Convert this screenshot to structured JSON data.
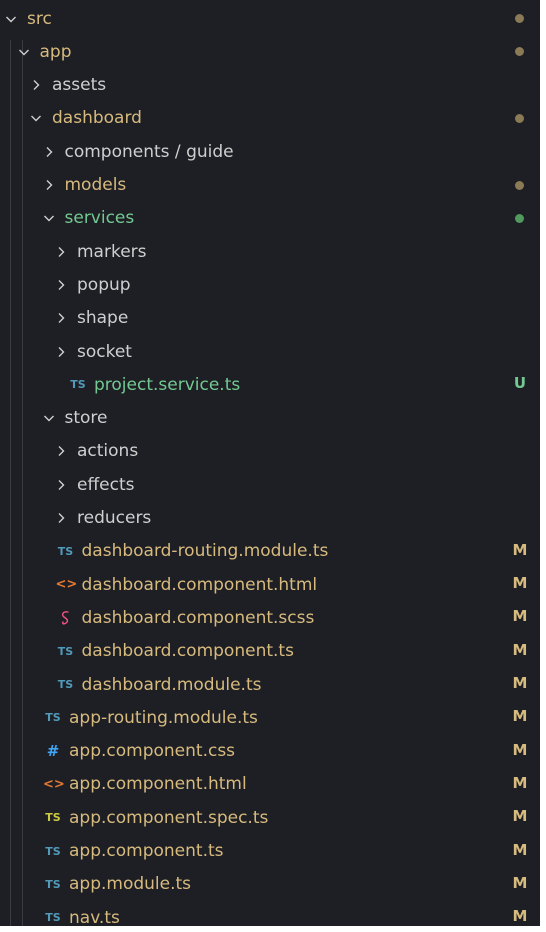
{
  "colors": {
    "background": "#1e1f25",
    "folder_text": "#cfcfcf",
    "modified_text": "#d7ba7d",
    "untracked_text": "#73c991",
    "modified_dot": "#8a7a55",
    "untracked_dot": "#4f9a5c",
    "ts_icon": "#519aba",
    "spec_icon": "#cbcb41",
    "html_icon": "#e37933",
    "css_icon": "#42a5f5",
    "scss_icon": "#f55385"
  },
  "tree": [
    {
      "name": "src",
      "kind": "folder",
      "depth": 0,
      "expanded": true,
      "dot": "modified"
    },
    {
      "name": "app",
      "kind": "folder",
      "depth": 1,
      "expanded": true,
      "dot": "modified"
    },
    {
      "name": "assets",
      "kind": "folder",
      "depth": 2,
      "expanded": false
    },
    {
      "name": "dashboard",
      "kind": "folder",
      "depth": 2,
      "expanded": true,
      "dot": "modified"
    },
    {
      "name": "components / guide",
      "kind": "folder",
      "depth": 3,
      "expanded": false
    },
    {
      "name": "models",
      "kind": "folder",
      "depth": 3,
      "expanded": false,
      "dot": "modified"
    },
    {
      "name": "services",
      "kind": "folder",
      "depth": 3,
      "expanded": true,
      "dot": "untracked"
    },
    {
      "name": "markers",
      "kind": "folder",
      "depth": 4,
      "expanded": false
    },
    {
      "name": "popup",
      "kind": "folder",
      "depth": 4,
      "expanded": false
    },
    {
      "name": "shape",
      "kind": "folder",
      "depth": 4,
      "expanded": false
    },
    {
      "name": "socket",
      "kind": "folder",
      "depth": 4,
      "expanded": false
    },
    {
      "name": "project.service.ts",
      "kind": "file",
      "icon": "TS",
      "icon_type": "ts",
      "depth": 4,
      "status": "U"
    },
    {
      "name": "store",
      "kind": "folder",
      "depth": 3,
      "expanded": true
    },
    {
      "name": "actions",
      "kind": "folder",
      "depth": 4,
      "expanded": false
    },
    {
      "name": "effects",
      "kind": "folder",
      "depth": 4,
      "expanded": false
    },
    {
      "name": "reducers",
      "kind": "folder",
      "depth": 4,
      "expanded": false
    },
    {
      "name": "dashboard-routing.module.ts",
      "kind": "file",
      "icon": "TS",
      "icon_type": "ts",
      "depth": 3,
      "status": "M"
    },
    {
      "name": "dashboard.component.html",
      "kind": "file",
      "icon": "<>",
      "icon_type": "html",
      "depth": 3,
      "status": "M"
    },
    {
      "name": "dashboard.component.scss",
      "kind": "file",
      "icon": "sass",
      "icon_type": "scss",
      "depth": 3,
      "status": "M"
    },
    {
      "name": "dashboard.component.ts",
      "kind": "file",
      "icon": "TS",
      "icon_type": "ts",
      "depth": 3,
      "status": "M"
    },
    {
      "name": "dashboard.module.ts",
      "kind": "file",
      "icon": "TS",
      "icon_type": "ts",
      "depth": 3,
      "status": "M"
    },
    {
      "name": "app-routing.module.ts",
      "kind": "file",
      "icon": "TS",
      "icon_type": "ts",
      "depth": 2,
      "status": "M"
    },
    {
      "name": "app.component.css",
      "kind": "file",
      "icon": "#",
      "icon_type": "css",
      "depth": 2,
      "status": "M"
    },
    {
      "name": "app.component.html",
      "kind": "file",
      "icon": "<>",
      "icon_type": "html",
      "depth": 2,
      "status": "M"
    },
    {
      "name": "app.component.spec.ts",
      "kind": "file",
      "icon": "TS",
      "icon_type": "spec",
      "depth": 2,
      "status": "M"
    },
    {
      "name": "app.component.ts",
      "kind": "file",
      "icon": "TS",
      "icon_type": "ts",
      "depth": 2,
      "status": "M"
    },
    {
      "name": "app.module.ts",
      "kind": "file",
      "icon": "TS",
      "icon_type": "ts",
      "depth": 2,
      "status": "M"
    },
    {
      "name": "nav.ts",
      "kind": "file",
      "icon": "TS",
      "icon_type": "ts",
      "depth": 2,
      "status": "M"
    }
  ]
}
